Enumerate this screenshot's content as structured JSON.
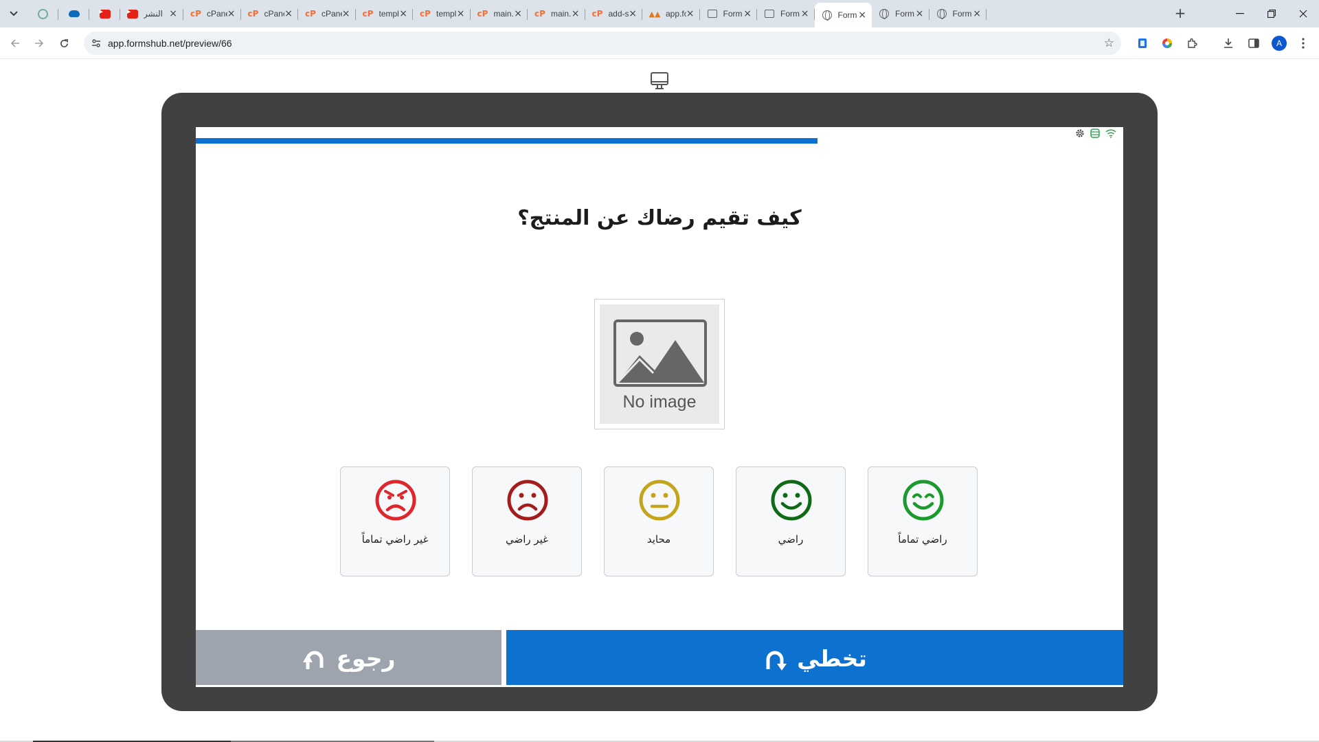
{
  "browser": {
    "tabs": [
      {
        "title": "",
        "icon": "chatgpt-icon",
        "pinned": true
      },
      {
        "title": "",
        "icon": "cloud-icon",
        "pinned": true
      },
      {
        "title": "",
        "icon": "youtube-icon",
        "pinned": true
      },
      {
        "title": "النشر",
        "icon": "youtube-icon"
      },
      {
        "title": "cPanel",
        "icon": "cpanel-icon"
      },
      {
        "title": "cPanel",
        "icon": "cpanel-icon"
      },
      {
        "title": "cPanel",
        "icon": "cpanel-icon"
      },
      {
        "title": "templ",
        "icon": "cpanel-icon"
      },
      {
        "title": "templ",
        "icon": "cpanel-icon"
      },
      {
        "title": "main.",
        "icon": "cpanel-icon"
      },
      {
        "title": "main.",
        "icon": "cpanel-icon"
      },
      {
        "title": "add-s",
        "icon": "cpanel-icon"
      },
      {
        "title": "app.fo",
        "icon": "app-icon"
      },
      {
        "title": "Form",
        "icon": "form-icon"
      },
      {
        "title": "Form",
        "icon": "form-icon"
      },
      {
        "title": "Form",
        "icon": "globe-icon",
        "active": true
      },
      {
        "title": "Form",
        "icon": "globe-icon"
      },
      {
        "title": "Form",
        "icon": "globe-icon"
      }
    ],
    "url": "app.formshub.net/preview/66",
    "avatar_letter": "A"
  },
  "form": {
    "progress": 0.67,
    "question": "كيف تقيم رضاك عن المنتج؟",
    "image_placeholder": "No image",
    "options": [
      {
        "label": "راضي تماماً",
        "face": "very-happy",
        "color": "#1a9a2c"
      },
      {
        "label": "راضي",
        "face": "happy",
        "color": "#0f6a16"
      },
      {
        "label": "محايد",
        "face": "neutral",
        "color": "#c4a41a"
      },
      {
        "label": "غير راضي",
        "face": "sad",
        "color": "#a51c1c"
      },
      {
        "label": "غير راضي تماماً",
        "face": "angry",
        "color": "#e0262d"
      }
    ],
    "skip_label": "تخطي",
    "back_label": "رجوع",
    "colors": {
      "primary": "#0d72cf",
      "back_button": "#9ea4ad",
      "device_frame": "#414141"
    }
  }
}
